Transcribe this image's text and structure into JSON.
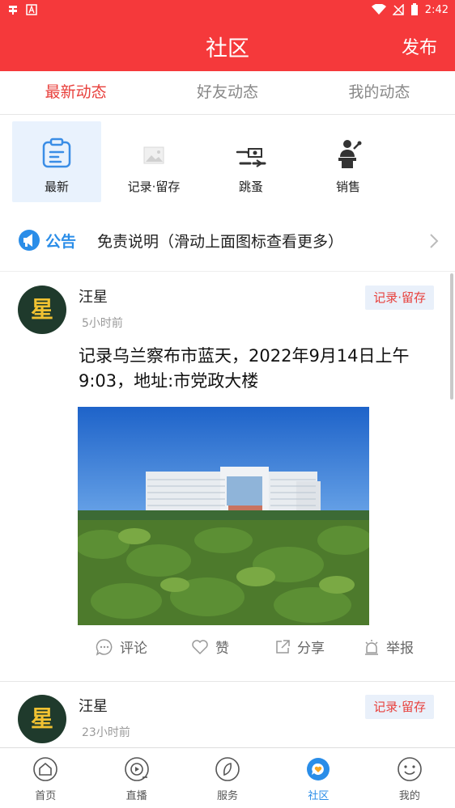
{
  "status_bar": {
    "time": "2:42",
    "app_icons": [
      "bug-icon",
      "letter-a-icon"
    ],
    "system_icons": [
      "wifi-icon",
      "no-signal-icon",
      "battery-icon"
    ]
  },
  "header": {
    "title": "社区",
    "publish_label": "发布"
  },
  "tabs": [
    {
      "label": "最新动态",
      "active": true
    },
    {
      "label": "好友动态",
      "active": false
    },
    {
      "label": "我的动态",
      "active": false
    }
  ],
  "categories": [
    {
      "label": "最新",
      "icon": "notepad-icon",
      "active": true
    },
    {
      "label": "记录·留存",
      "icon": "image-icon",
      "active": false
    },
    {
      "label": "跳蚤",
      "icon": "money-exchange-icon",
      "active": false
    },
    {
      "label": "销售",
      "icon": "speaker-podium-icon",
      "active": false
    }
  ],
  "notice": {
    "badge": "公告",
    "text": "免责说明（滑动上面图标查看更多）"
  },
  "posts": [
    {
      "avatar_text": "星",
      "author": "汪星",
      "time": "5小时前",
      "tag": "记录·留存",
      "content": "记录乌兰察布市蓝天，2022年9月14日上午9:03，地址:市党政大楼",
      "actions": {
        "comment": "评论",
        "like": "赞",
        "share": "分享",
        "report": "举报"
      }
    },
    {
      "avatar_text": "星",
      "author": "汪星",
      "time": "23小时前",
      "tag": "记录·留存"
    }
  ],
  "bottom_nav": [
    {
      "label": "首页",
      "icon": "home-icon",
      "active": false
    },
    {
      "label": "直播",
      "icon": "live-play-icon",
      "active": false
    },
    {
      "label": "服务",
      "icon": "compass-icon",
      "active": false
    },
    {
      "label": "社区",
      "icon": "community-chat-icon",
      "active": true
    },
    {
      "label": "我的",
      "icon": "smile-face-icon",
      "active": false
    }
  ],
  "colors": {
    "brand_red": "#f5393b",
    "active_tab": "#e8403c",
    "accent_blue": "#2a8de8"
  }
}
